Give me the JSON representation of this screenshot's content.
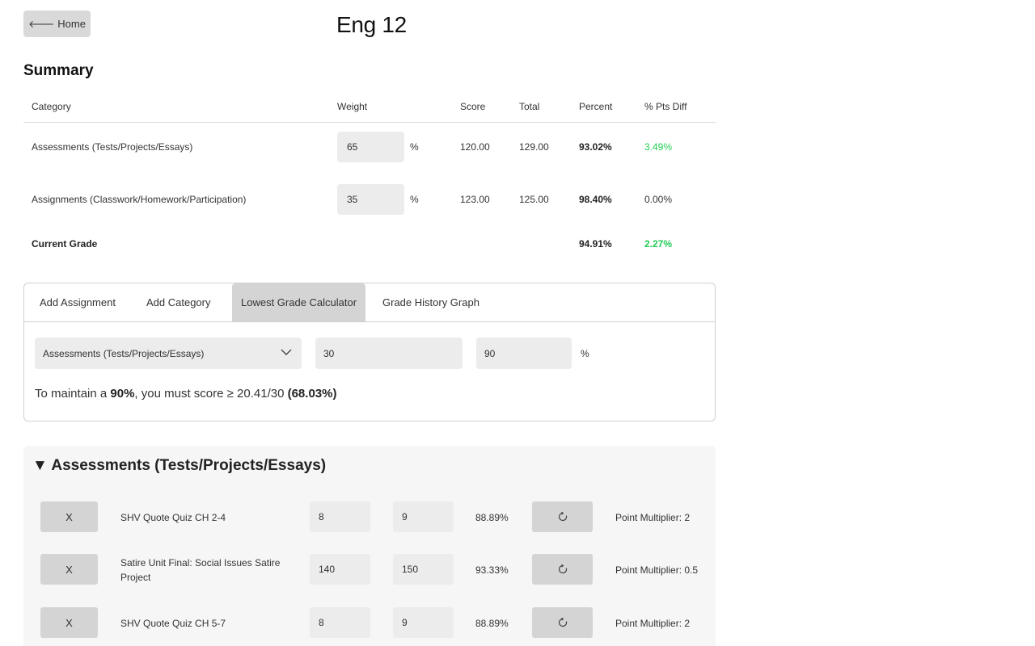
{
  "header": {
    "home_label": "Home",
    "title": "Eng 12"
  },
  "summary": {
    "title": "Summary",
    "columns": [
      "Category",
      "Weight",
      "Score",
      "Total",
      "Percent",
      "% Pts Diff"
    ],
    "rows": [
      {
        "category": "Assessments (Tests/Projects/Essays)",
        "weight": "65",
        "weight_unit": "%",
        "score": "120.00",
        "total": "129.00",
        "percent": "93.02%",
        "diff": "3.49%"
      },
      {
        "category": "Assignments (Classwork/Homework/Participation)",
        "weight": "35",
        "weight_unit": "%",
        "score": "123.00",
        "total": "125.00",
        "percent": "98.40%",
        "diff": "0.00%"
      }
    ],
    "current": {
      "label": "Current Grade",
      "percent": "94.91%",
      "diff": "2.27%"
    }
  },
  "tabs": [
    "Add Assignment",
    "Add Category",
    "Lowest Grade Calculator",
    "Grade History Graph"
  ],
  "calculator": {
    "category_selected": "Assessments (Tests/Projects/Essays)",
    "points_value": "30",
    "target_value": "90",
    "target_unit": "%",
    "result_prefix": "To maintain a ",
    "result_target": "90%",
    "result_mid": ", you must score ≥ 20.41/30 ",
    "result_pct": "(68.03%)"
  },
  "category_card": {
    "title": "▼ Assessments (Tests/Projects/Essays)",
    "assignments": [
      {
        "delete_label": "X",
        "name": "SHV Quote Quiz CH 2-4",
        "score": "8",
        "total": "9",
        "percent": "88.89%",
        "multiplier": "Point Multiplier: 2"
      },
      {
        "delete_label": "X",
        "name": "Satire Unit Final: Social Issues Satire Project",
        "score": "140",
        "total": "150",
        "percent": "93.33%",
        "multiplier": "Point Multiplier: 0.5"
      },
      {
        "delete_label": "X",
        "name": "SHV Quote Quiz CH 5-7",
        "score": "8",
        "total": "9",
        "percent": "88.89%",
        "multiplier": "Point Multiplier: 2"
      }
    ]
  },
  "colors": {
    "positive": "#22cc55",
    "button_bg": "#d4d4d4",
    "input_bg": "#ececec"
  },
  "icons": {
    "home": "arrow-left-icon",
    "select": "chevron-down-icon",
    "reset": "reset-icon"
  }
}
